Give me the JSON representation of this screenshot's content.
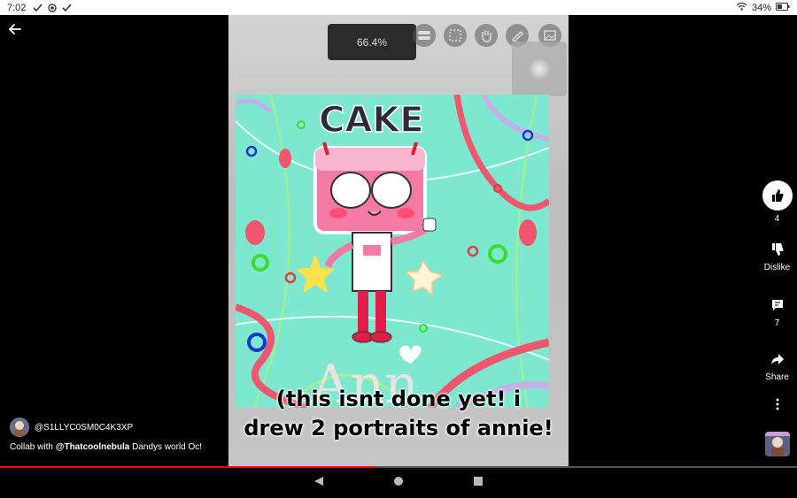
{
  "status_bar": {
    "time": "7:02",
    "battery": "34%"
  },
  "video": {
    "zoom_level": "66.4%",
    "caption_line1": "(this isnt done yet! i",
    "caption_line2": "drew 2 portraits of annie!",
    "art_text": "CAKE"
  },
  "actions": {
    "like_count": "4",
    "dislike_label": "Dislike",
    "comment_count": "7",
    "share_label": "Share"
  },
  "channel": {
    "handle": "@S1LLYC0SM0C4K3XP",
    "description_prefix": "Collab with ",
    "description_mention": "@Thatcoolnebula",
    "description_suffix": "  Dandys world Oc!"
  },
  "progress": {
    "fraction": 0.47
  },
  "colors": {
    "accent": "#ff0000",
    "canvas_bg": "#7de8cf",
    "character_pink": "#f47aa6"
  }
}
